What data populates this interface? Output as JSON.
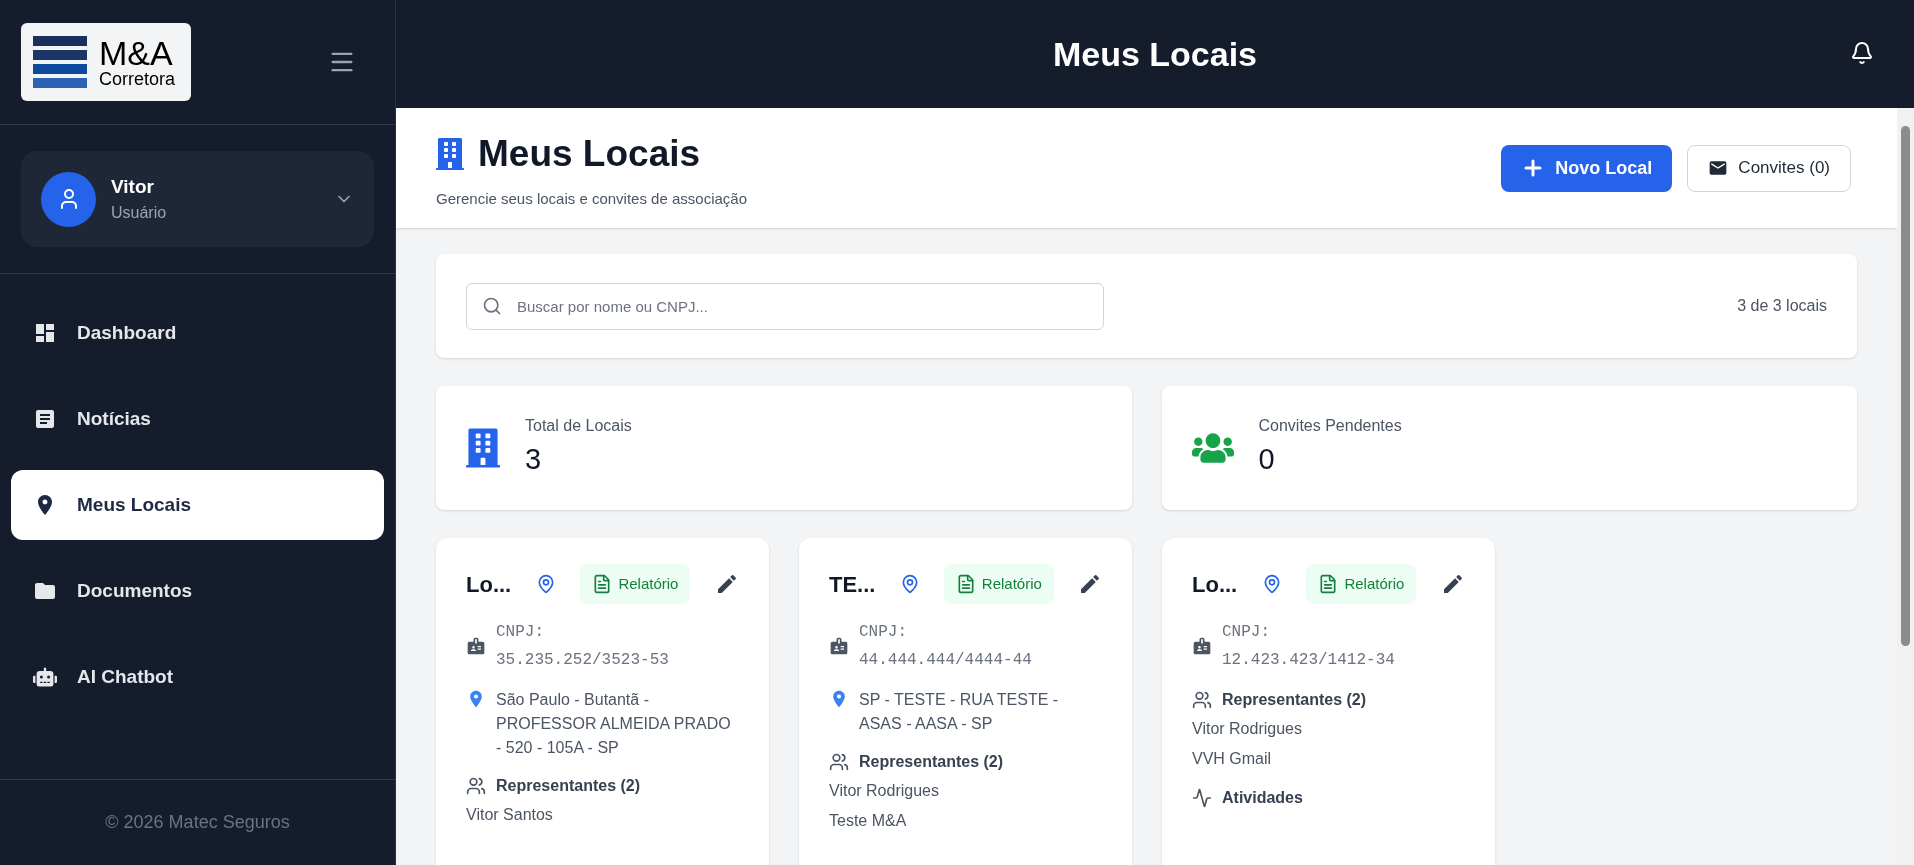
{
  "logo": {
    "mark": "M&A",
    "sub": "Corretora"
  },
  "user": {
    "name": "Vitor",
    "role": "Usuário"
  },
  "sidebar": {
    "items": [
      {
        "kind": "dashboard",
        "label": "Dashboard",
        "selected": false
      },
      {
        "kind": "news",
        "label": "Notícias",
        "selected": false
      },
      {
        "kind": "pin",
        "label": "Meus Locais",
        "selected": true
      },
      {
        "kind": "folder",
        "label": "Documentos",
        "selected": false
      },
      {
        "kind": "robot",
        "label": "AI Chatbot",
        "selected": false
      }
    ]
  },
  "footer": "© 2026 Matec Seguros",
  "topbar": {
    "title": "Meus Locais"
  },
  "page": {
    "title": "Meus Locais",
    "subtitle": "Gerencie seus locais e convites de associação",
    "buttons": [
      {
        "kind": "primary",
        "label": "Novo Local"
      },
      {
        "kind": "secondary",
        "label": "Convites (0)"
      }
    ]
  },
  "search": {
    "placeholder": "Buscar por nome ou CNPJ...",
    "count": "3 de 3 locais"
  },
  "stats": [
    {
      "kind": "building",
      "label": "Total de Locais",
      "value": "3"
    },
    {
      "kind": "people",
      "label": "Convites Pendentes",
      "value": "0"
    }
  ],
  "cards": [
    {
      "title": "Lo...",
      "report": "Relatório",
      "cnpj": "CNPJ: 35.235.252/3523-53",
      "address": "São Paulo - Butantã - PROFESSOR ALMEIDA PRADO - 520 - 105A - SP",
      "sections": [
        {
          "kind": "representantes",
          "title": "Representantes (2)",
          "items": [
            "Vitor Santos"
          ]
        }
      ]
    },
    {
      "title": "TE...",
      "report": "Relatório",
      "cnpj": "CNPJ: 44.444.444/4444-44",
      "address": "SP - TESTE - RUA TESTE - ASAS - AASA - SP",
      "sections": [
        {
          "kind": "representantes",
          "title": "Representantes (2)",
          "items": [
            "Vitor Rodrigues",
            "Teste M&A"
          ]
        }
      ]
    },
    {
      "title": "Lo...",
      "report": "Relatório",
      "cnpj": "CNPJ: 12.423.423/1412-34",
      "sections": [
        {
          "kind": "representantes",
          "title": "Representantes (2)",
          "items": [
            "Vitor Rodrigues",
            "VVH Gmail"
          ]
        },
        {
          "kind": "atividades",
          "title": "Atividades"
        }
      ]
    }
  ]
}
